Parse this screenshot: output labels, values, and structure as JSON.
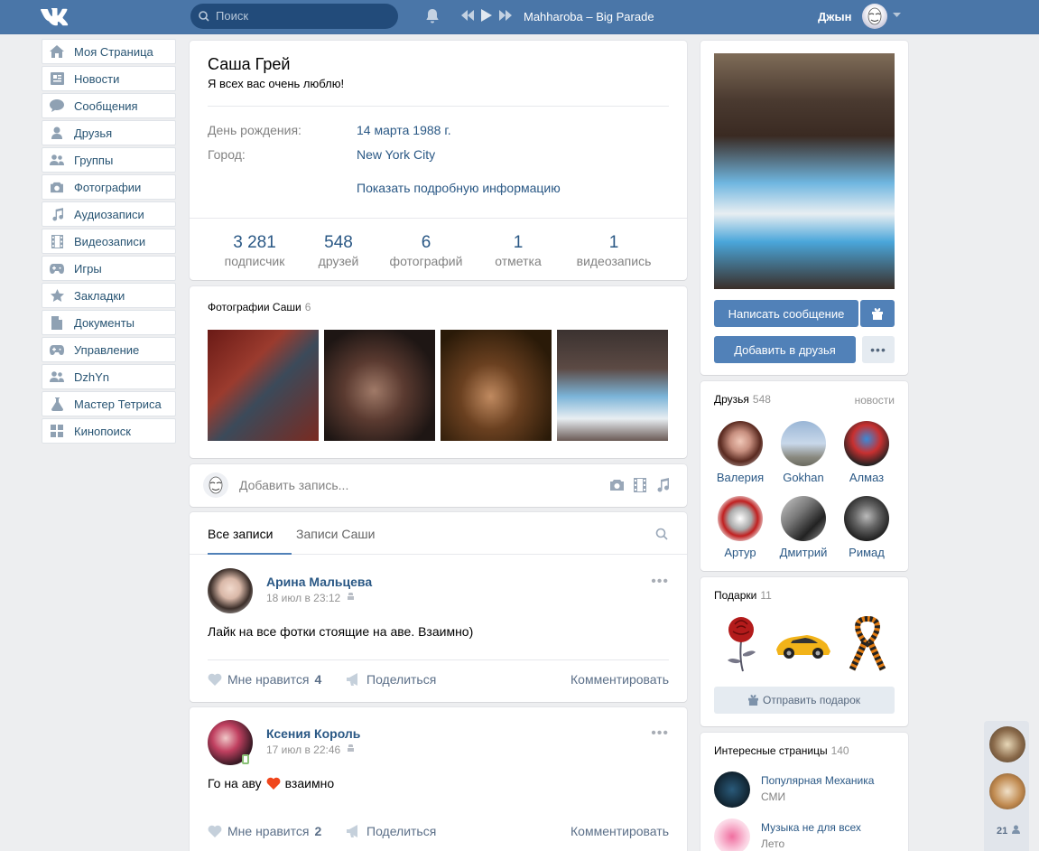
{
  "header": {
    "search_placeholder": "Поиск",
    "track": "Mahharoba – Big Parade",
    "user_name": "Джын"
  },
  "leftnav": {
    "items": [
      {
        "label": "Моя Страница",
        "icon": "home-icon"
      },
      {
        "label": "Новости",
        "icon": "news-icon"
      },
      {
        "label": "Сообщения",
        "icon": "message-icon"
      },
      {
        "label": "Друзья",
        "icon": "user-icon"
      },
      {
        "label": "Группы",
        "icon": "group-icon"
      },
      {
        "label": "Фотографии",
        "icon": "camera-icon"
      },
      {
        "label": "Аудиозаписи",
        "icon": "music-icon"
      },
      {
        "label": "Видеозаписи",
        "icon": "film-icon"
      },
      {
        "label": "Игры",
        "icon": "gamepad-icon"
      },
      {
        "label": "Закладки",
        "icon": "star-icon"
      },
      {
        "label": "Документы",
        "icon": "document-icon"
      },
      {
        "label": "Управление",
        "icon": "gamepad-icon"
      },
      {
        "label": "DzhYn",
        "icon": "group-icon"
      },
      {
        "label": "Мастер Тетриса",
        "icon": "flask-icon"
      },
      {
        "label": "Кинопоиск",
        "icon": "grid-icon"
      }
    ]
  },
  "profile": {
    "name": "Саша Грей",
    "status": "Я всех вас очень люблю!",
    "birthday_label": "День рождения:",
    "birthday_value": "14 марта 1988 г.",
    "city_label": "Город:",
    "city_value": "New York City",
    "more_info": "Показать подробную информацию",
    "counters": [
      {
        "num": "3 281",
        "label": "подписчик"
      },
      {
        "num": "548",
        "label": "друзей"
      },
      {
        "num": "6",
        "label": "фотографий"
      },
      {
        "num": "1",
        "label": "отметка"
      },
      {
        "num": "1",
        "label": "видеозапись"
      }
    ]
  },
  "photos": {
    "title": "Фотографии Саши",
    "count": "6"
  },
  "compose": {
    "placeholder": "Добавить запись..."
  },
  "wall": {
    "tab_all": "Все записи",
    "tab_own": "Записи Саши"
  },
  "posts": [
    {
      "author": "Арина Мальцева",
      "date": "18 июл в 23:12",
      "text": "Лайк на все фотки стоящие на аве. Взаимно)",
      "like_label": "Мне нравится",
      "like_count": "4",
      "share_label": "Поделиться",
      "comment_label": "Комментировать"
    },
    {
      "author": "Ксения Король",
      "date": "17 июл в 22:46",
      "text_before": "Го на аву",
      "text_after": "взаимно",
      "like_label": "Мне нравится",
      "like_count": "2",
      "share_label": "Поделиться",
      "comment_label": "Комментировать"
    }
  ],
  "actions": {
    "write_message": "Написать сообщение",
    "add_friend": "Добавить в друзья"
  },
  "friends": {
    "title": "Друзья",
    "count": "548",
    "news_link": "новости",
    "list": [
      "Валерия",
      "Gokhan",
      "Алмаз",
      "Артур",
      "Дмитрий",
      "Римад"
    ]
  },
  "gifts": {
    "title": "Подарки",
    "count": "11",
    "send_label": "Отправить подарок"
  },
  "pages": {
    "title": "Интересные страницы",
    "count": "140",
    "list": [
      {
        "name": "Популярная Механика",
        "sub": "СМИ"
      },
      {
        "name": "Музыка не для всех",
        "sub": "Лето"
      }
    ]
  },
  "chat": {
    "online_count": "21"
  },
  "colors": {
    "header_bg": "#4a76a8",
    "accent": "#5181b8",
    "link": "#2a5885",
    "page_bg": "#edeef0"
  }
}
